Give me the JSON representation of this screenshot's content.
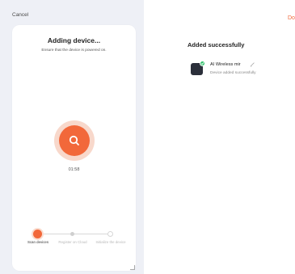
{
  "left": {
    "cancel_label": "Cancel",
    "title": "Adding device...",
    "subtitle": "Ensure that the device is powered on.",
    "timer": "01:58",
    "steps": [
      {
        "label": "Scan devices",
        "state": "active"
      },
      {
        "label": "Register on Cloud",
        "state": "pending"
      },
      {
        "label": "Initialize the device",
        "state": "pending"
      }
    ]
  },
  "right": {
    "done_label": "Do",
    "title": "Added successfully",
    "device": {
      "name": "AI Wireless mir",
      "status": "Device added successfully"
    }
  },
  "colors": {
    "accent": "#f2683a",
    "success": "#2fbf6b",
    "panel_bg": "#eef0f6"
  },
  "icons": [
    "search-icon",
    "check-icon",
    "edit-pencil-icon",
    "device-icon"
  ]
}
